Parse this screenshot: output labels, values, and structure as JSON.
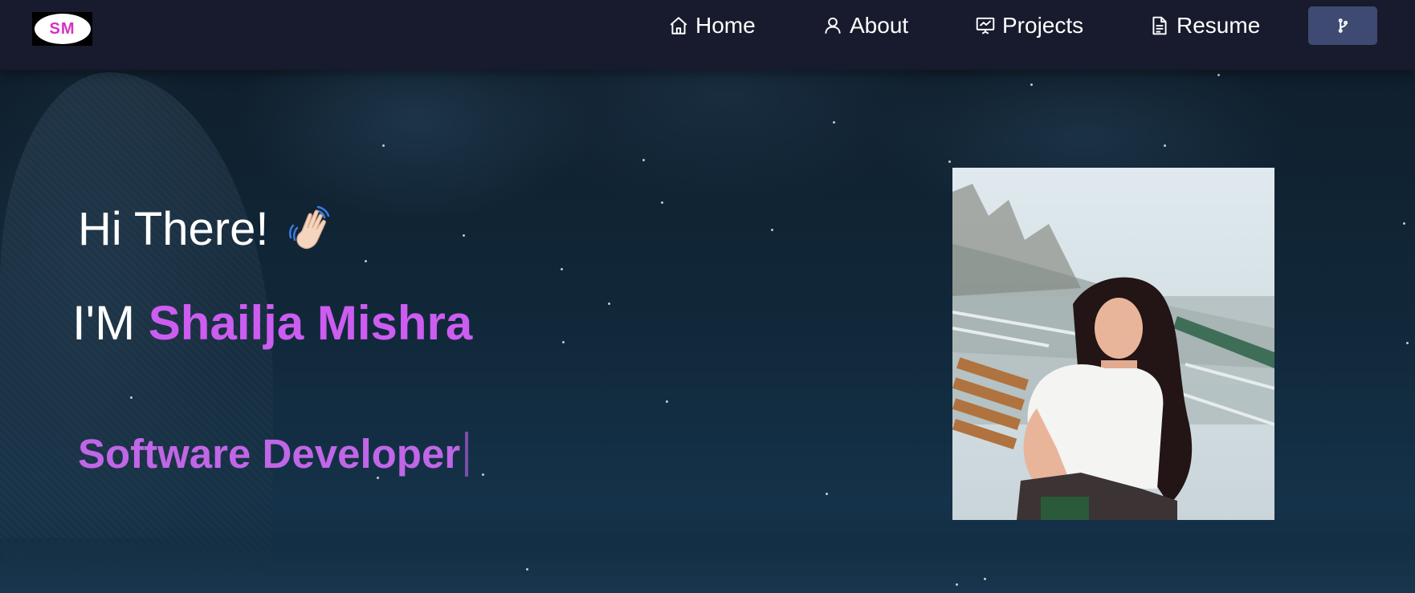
{
  "navbar": {
    "logo_text": "SM",
    "items": [
      {
        "label": "Home",
        "icon": "home-icon"
      },
      {
        "label": "About",
        "icon": "user-icon"
      },
      {
        "label": "Projects",
        "icon": "presentation-icon"
      },
      {
        "label": "Resume",
        "icon": "document-icon"
      }
    ],
    "fork_button_icon": "git-fork-icon"
  },
  "hero": {
    "greeting": "Hi There!",
    "wave_icon": "waving-hand-icon",
    "intro_prefix": "I'M",
    "name": "Shailja Mishra",
    "role": "Software Developer",
    "photo_icon": "profile-photo"
  },
  "colors": {
    "navbar_bg": "#181b2d",
    "accent_purple": "#cc5df0",
    "role_purple": "#c066e6",
    "button_bg": "#3f4a72"
  }
}
